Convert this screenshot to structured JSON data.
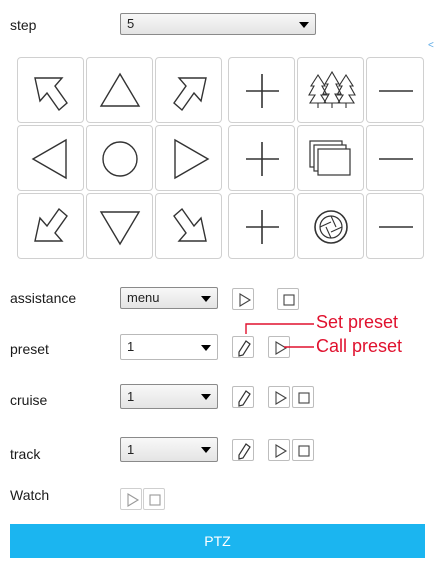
{
  "step": {
    "label": "step",
    "value": "5"
  },
  "side_mark": "<",
  "assistance": {
    "label": "assistance",
    "value": "menu"
  },
  "preset": {
    "label": "preset",
    "value": "1"
  },
  "cruise": {
    "label": "cruise",
    "value": "1"
  },
  "track": {
    "label": "track",
    "value": "1"
  },
  "watch": {
    "label": "Watch"
  },
  "annotations": {
    "set_preset": "Set preset",
    "call_preset": "Call preset"
  },
  "ptz_button": "PTZ",
  "icons": {
    "direction_pad": [
      "up-left-arrow-icon",
      "up-arrow-icon",
      "up-right-arrow-icon",
      "left-arrow-icon",
      "center-circle-icon",
      "right-arrow-icon",
      "down-left-arrow-icon",
      "down-arrow-icon",
      "down-right-arrow-icon"
    ],
    "lens_controls": [
      "zoom-plus-icon",
      "trees-icon",
      "zoom-minus-icon",
      "focus-plus-icon",
      "windows-icon",
      "focus-minus-icon",
      "iris-plus-icon",
      "iris-icon",
      "iris-minus-icon"
    ],
    "actions": [
      "edit-pencil-icon",
      "play-icon",
      "stop-icon"
    ]
  },
  "colors": {
    "accent": "#1bb5f0",
    "annotation": "#e0112e"
  }
}
